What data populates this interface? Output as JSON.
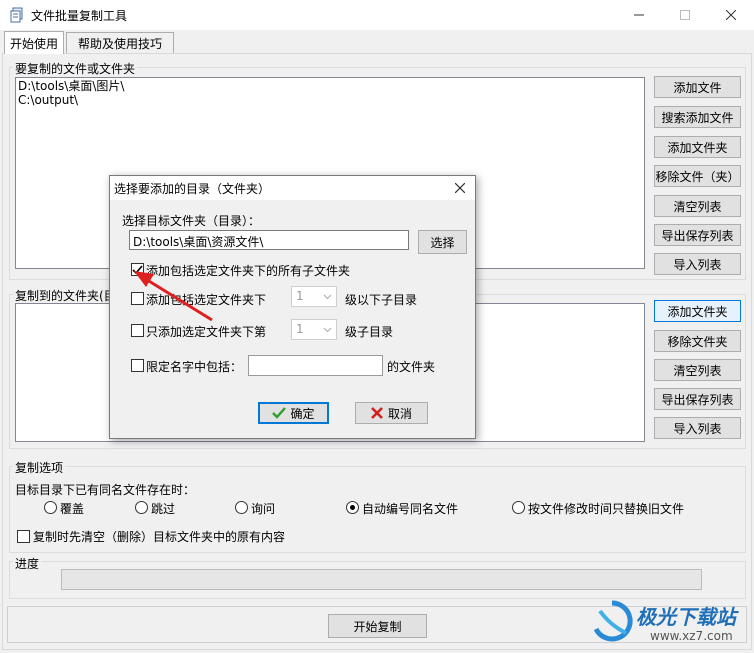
{
  "window": {
    "title": "文件批量复制工具"
  },
  "tabs": [
    {
      "label": "开始使用",
      "active": true
    },
    {
      "label": "帮助及使用技巧",
      "active": false
    }
  ],
  "source": {
    "group_title": "要复制的文件或文件夹",
    "items": [
      "D:\\tools\\桌面\\图片\\",
      "C:\\output\\"
    ],
    "buttons": [
      "添加文件",
      "搜索添加文件",
      "添加文件夹",
      "移除文件（夹）",
      "清空列表",
      "导出保存列表",
      "导入列表"
    ]
  },
  "target": {
    "group_title": "复制到的文件夹(目",
    "items": [],
    "buttons": [
      "添加文件夹",
      "移除文件夹",
      "清空列表",
      "导出保存列表",
      "导入列表"
    ]
  },
  "copy_options": {
    "group_title": "复制选项",
    "exists_label": "目标目录下已有同名文件存在时：",
    "radios": [
      {
        "label": "覆盖",
        "checked": false
      },
      {
        "label": "跳过",
        "checked": false
      },
      {
        "label": "询问",
        "checked": false
      },
      {
        "label": "自动编号同名文件",
        "checked": true
      },
      {
        "label": "按文件修改时间只替换旧文件",
        "checked": false
      }
    ],
    "clear_first_label": "复制时先清空（删除）目标文件夹中的原有内容",
    "clear_first_checked": false
  },
  "progress": {
    "label": "进度",
    "value": 0
  },
  "start_button": "开始复制",
  "dialog": {
    "title": "选择要添加的目录（文件夹）",
    "target_label": "选择目标文件夹（目录）：",
    "target_path": "D:\\tools\\桌面\\资源文件\\",
    "browse_button": "选择",
    "opt_all_label": "添加包括选定文件夹下的所有子文件夹",
    "opt_all_checked": true,
    "opt_levels_label": "添加包括选定文件夹下",
    "opt_levels_value": "1",
    "opt_levels_suffix": "级以下子目录",
    "opt_levels_checked": false,
    "opt_only_label": "只添加选定文件夹下第",
    "opt_only_value": "1",
    "opt_only_suffix": "级子目录",
    "opt_only_checked": false,
    "opt_name_label": "限定名字中包括：",
    "opt_name_value": "",
    "opt_name_suffix": "的文件夹",
    "opt_name_checked": false,
    "ok_button": "确定",
    "cancel_button": "取消"
  },
  "watermark": {
    "brand": "极光下载站",
    "url": "www.xz7.com"
  },
  "colors": {
    "accent": "#0078d7",
    "annotation_arrow": "#e02020",
    "ok_icon": "#2e9e2e",
    "cancel_icon": "#d02020"
  }
}
